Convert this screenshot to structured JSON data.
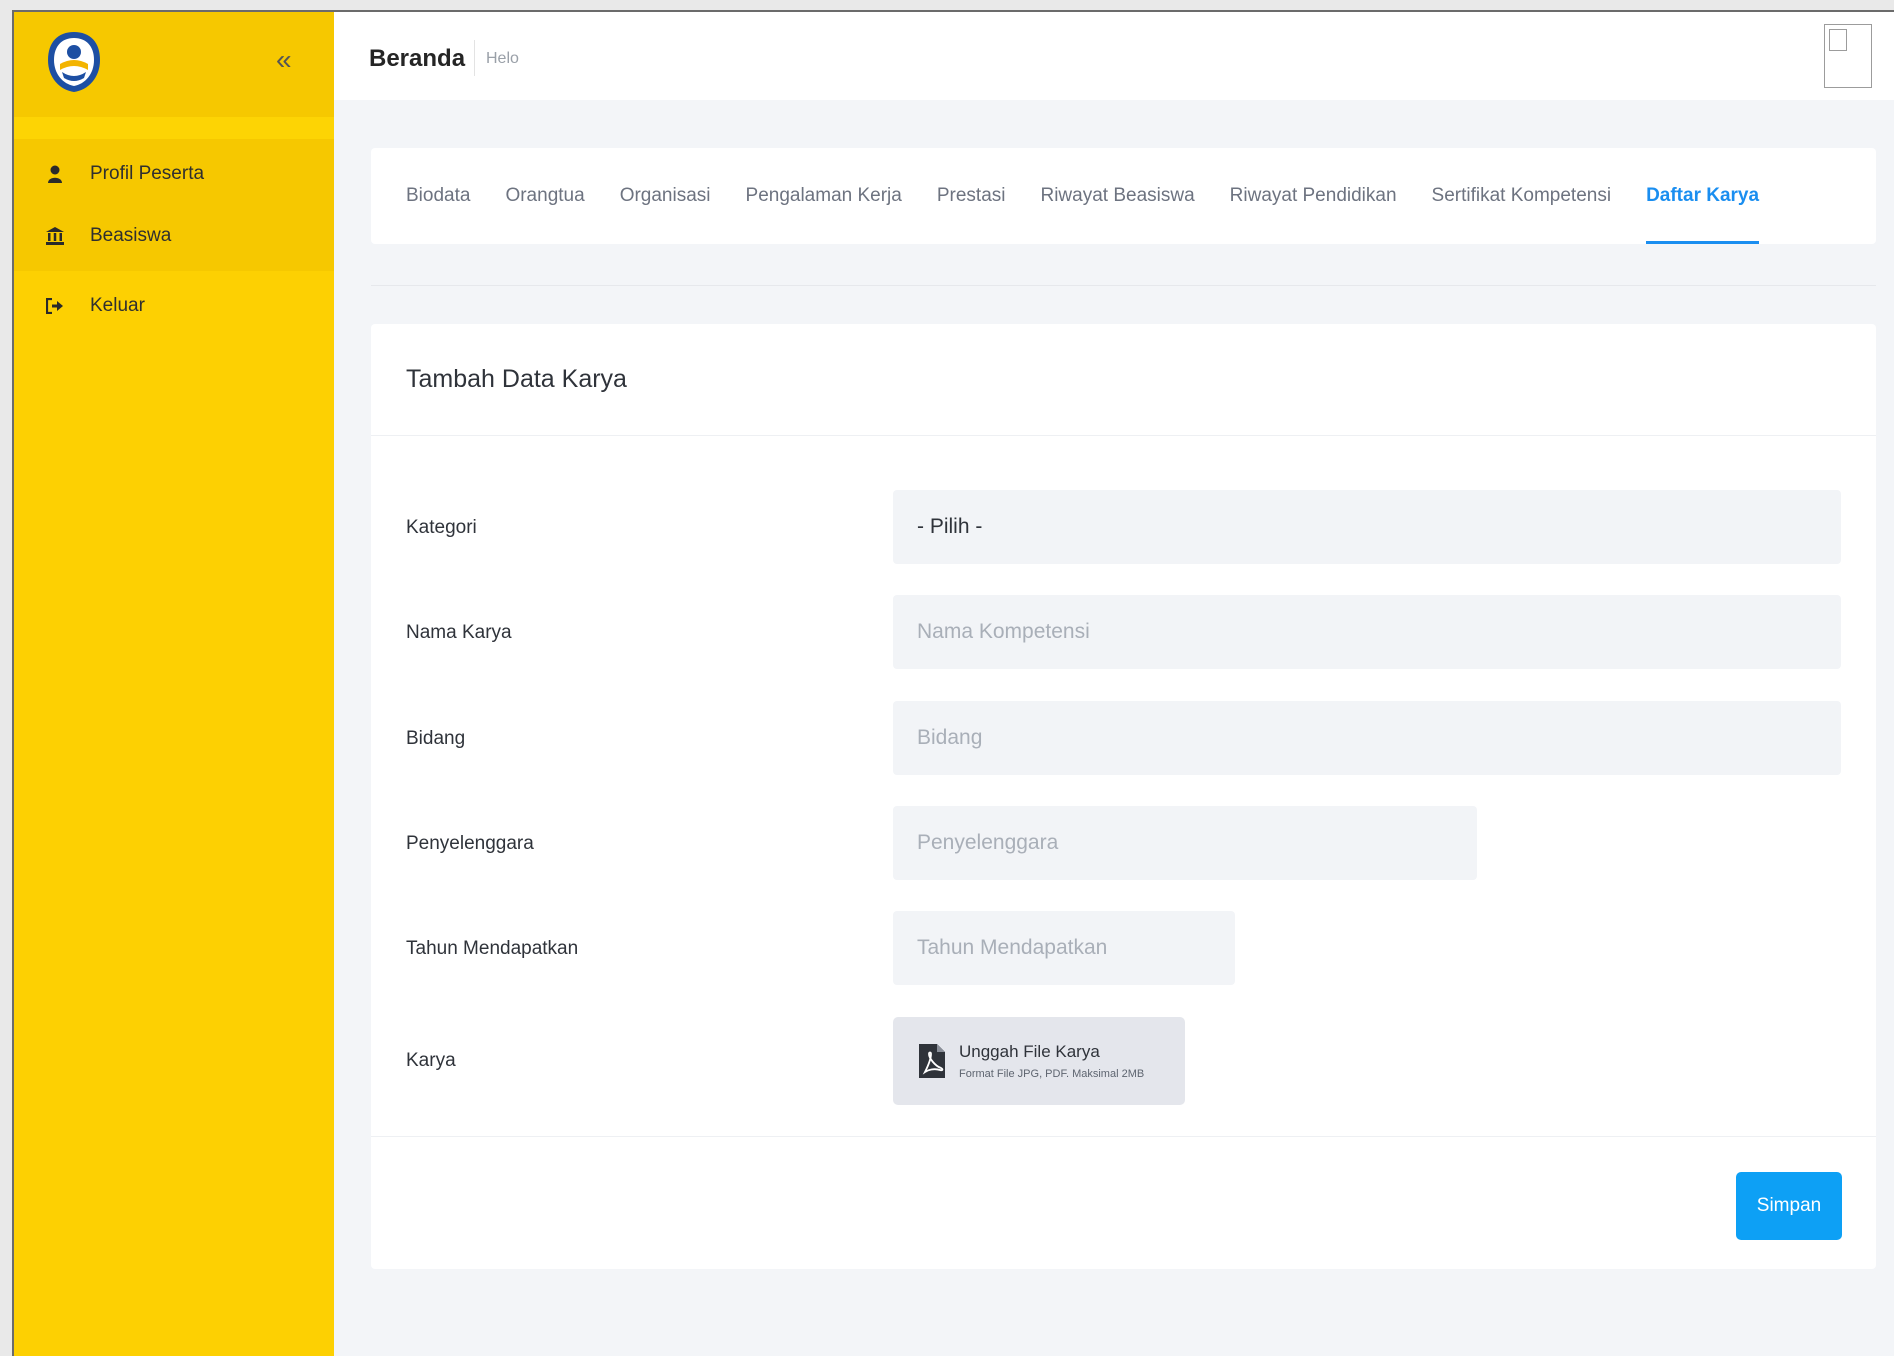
{
  "sidebar": {
    "collapse_icon": "chevron-double-left-icon",
    "items": [
      {
        "label": "Profil Peserta",
        "icon": "user-icon"
      },
      {
        "label": "Beasiswa",
        "icon": "bank-icon"
      },
      {
        "label": "Keluar",
        "icon": "sign-out-icon"
      }
    ]
  },
  "topbar": {
    "title": "Beranda",
    "subtitle": "Helo"
  },
  "tabs": [
    {
      "label": "Biodata"
    },
    {
      "label": "Orangtua"
    },
    {
      "label": "Organisasi"
    },
    {
      "label": "Pengalaman Kerja"
    },
    {
      "label": "Prestasi"
    },
    {
      "label": "Riwayat Beasiswa"
    },
    {
      "label": "Riwayat Pendidikan"
    },
    {
      "label": "Sertifikat Kompetensi"
    },
    {
      "label": "Daftar Karya",
      "active": true
    }
  ],
  "form": {
    "title": "Tambah Data Karya",
    "kategori": {
      "label": "Kategori",
      "value": "- Pilih -"
    },
    "nama_karya": {
      "label": "Nama Karya",
      "placeholder": "Nama Kompetensi"
    },
    "bidang": {
      "label": "Bidang",
      "placeholder": "Bidang"
    },
    "penyelenggara": {
      "label": "Penyelenggara",
      "placeholder": "Penyelenggara"
    },
    "tahun": {
      "label": "Tahun Mendapatkan",
      "placeholder": "Tahun Mendapatkan"
    },
    "karya": {
      "label": "Karya",
      "upload_title": "Unggah File Karya",
      "upload_hint": "Format File JPG, PDF. Maksimal 2MB"
    },
    "save_label": "Simpan"
  },
  "colors": {
    "sidebar": "#fdd002",
    "accent": "#1a8ef0",
    "save_button": "#0da0f5"
  }
}
